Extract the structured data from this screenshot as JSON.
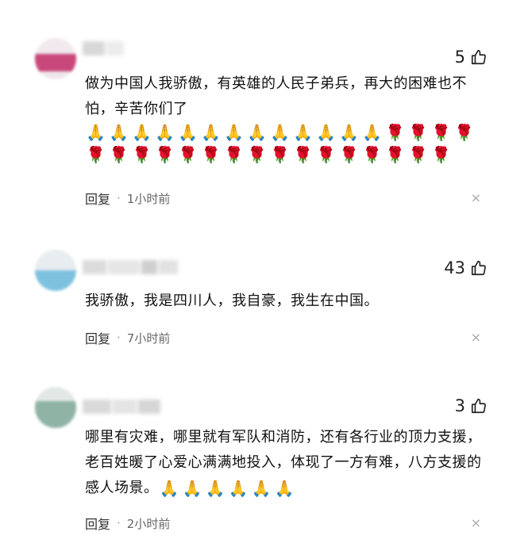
{
  "comments": [
    {
      "likes": "5",
      "text": "做为中国人我骄傲，有英雄的人民子弟兵，再大的困难也不怕，辛苦你们了",
      "emojis": [
        "🙏",
        "🙏",
        "🙏",
        "🙏",
        "🙏",
        "🙏",
        "🙏",
        "🙏",
        "🙏",
        "🙏",
        "🙏",
        "🙏",
        "🙏",
        "🌹",
        "🌹",
        "🌹",
        "🌹",
        "🌹",
        "🌹",
        "🌹",
        "🌹",
        "🌹",
        "🌹",
        "🌹",
        "🌹",
        "🌹",
        "🌹",
        "🌹",
        "🌹",
        "🌹",
        "🌹",
        "🌹",
        "🌹"
      ],
      "reply_label": "回复",
      "dot": "·",
      "time": "1小时前",
      "close": "×"
    },
    {
      "likes": "43",
      "text": "我骄傲，我是四川人，我自豪，我生在中国。",
      "emojis": [],
      "reply_label": "回复",
      "dot": "·",
      "time": "7小时前",
      "close": "×"
    },
    {
      "likes": "3",
      "text": "哪里有灾难，哪里就有军队和消防，还有各行业的顶力支援，老百姓暖了心爱心满满地投入，体现了一方有难，八方支援的感人场景。",
      "emojis": [
        "🙏",
        "🙏",
        "🙏",
        "🙏",
        "🙏",
        "🙏"
      ],
      "reply_label": "回复",
      "dot": "·",
      "time": "2小时前",
      "close": "×"
    }
  ],
  "icons": {
    "like": "thumbs-up-icon",
    "close": "close-icon"
  },
  "colors": {
    "avatar1": [
      "#f2e7ee",
      "#c9497b"
    ],
    "avatar2": [
      "#e6ecef",
      "#7cc2e0"
    ],
    "avatar3": [
      "#dfe6e4",
      "#8fb5a6"
    ]
  }
}
